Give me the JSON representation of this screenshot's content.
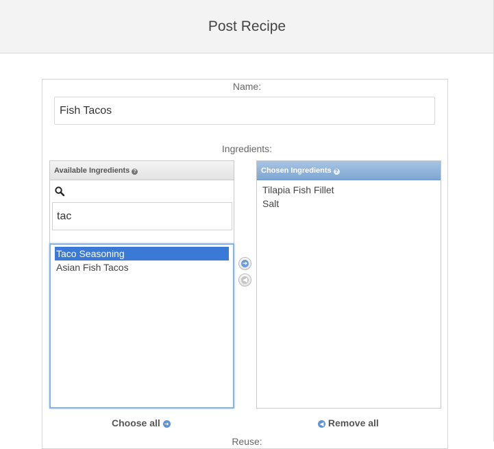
{
  "header": {
    "title": "Post Recipe"
  },
  "form": {
    "name_label": "Name:",
    "name_value": "Fish Tacos",
    "ingredients_label": "Ingredients:",
    "next_label": "Reuse:"
  },
  "available": {
    "header": "Available Ingredients",
    "help_glyph": "?",
    "filter_value": "tac",
    "items": [
      "Taco Seasoning",
      "Asian Fish Tacos"
    ],
    "selected_index": 0,
    "choose_all_label": "Choose all"
  },
  "chosen": {
    "header": "Chosen Ingredients",
    "help_glyph": "?",
    "items": [
      "Tilapia Fish Fillet",
      "Salt"
    ],
    "remove_all_label": "Remove all"
  },
  "icons": {
    "add": "arrow-right-icon",
    "remove": "arrow-left-icon",
    "search": "search-icon",
    "help": "help-icon"
  },
  "colors": {
    "selected": "#3a79d6",
    "chosen_header": "#7fa6d2",
    "focus_border": "#88b3e0"
  }
}
